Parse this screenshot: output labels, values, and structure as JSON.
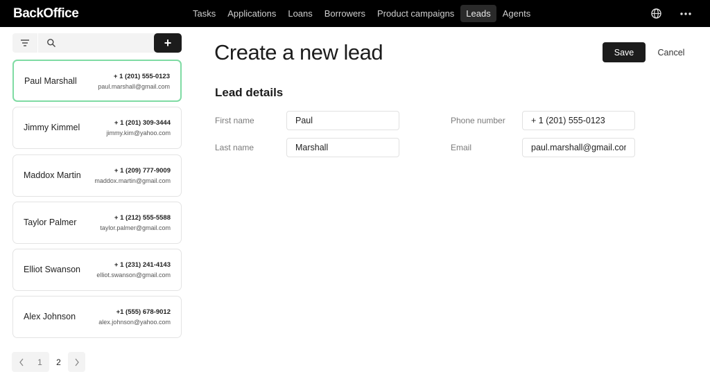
{
  "app": {
    "brand": "BackOffice"
  },
  "nav": {
    "items": [
      {
        "label": "Tasks",
        "active": false
      },
      {
        "label": "Applications",
        "active": false
      },
      {
        "label": "Loans",
        "active": false
      },
      {
        "label": "Borrowers",
        "active": false
      },
      {
        "label": "Product campaigns",
        "active": false
      },
      {
        "label": "Leads",
        "active": true
      },
      {
        "label": "Agents",
        "active": false
      }
    ],
    "icons": [
      "globe-icon",
      "more-icon"
    ]
  },
  "sidebar": {
    "filter_icon": "filter-icon",
    "search": {
      "icon": "search-icon",
      "placeholder": "",
      "value": ""
    },
    "add_label": "+",
    "leads": [
      {
        "name": "Paul Marshall",
        "phone": "+ 1 (201) 555-0123",
        "email": "paul.marshall@gmail.com",
        "selected": true
      },
      {
        "name": "Jimmy Kimmel",
        "phone": "+ 1 (201) 309-3444",
        "email": "jimmy.kim@yahoo.com",
        "selected": false
      },
      {
        "name": "Maddox Martin",
        "phone": "+ 1 (209) 777-9009",
        "email": "maddox.martin@gmail.com",
        "selected": false
      },
      {
        "name": "Taylor Palmer",
        "phone": "+ 1 (212) 555-5588",
        "email": "taylor.palmer@gmail.com",
        "selected": false
      },
      {
        "name": "Elliot Swanson",
        "phone": "+ 1 (231) 241-4143",
        "email": "elliot.swanson@gmail.com",
        "selected": false
      },
      {
        "name": "Alex Johnson",
        "phone": "+1 (555) 678-9012",
        "email": "alex.johnson@yahoo.com",
        "selected": false
      }
    ],
    "pagination": {
      "prev": "‹",
      "pages": [
        "1",
        "2"
      ],
      "current": "2",
      "next": "›"
    }
  },
  "main": {
    "title": "Create a new lead",
    "save_label": "Save",
    "cancel_label": "Cancel",
    "section_title": "Lead details",
    "fields": {
      "first_name": {
        "label": "First name",
        "value": "Paul"
      },
      "last_name": {
        "label": "Last name",
        "value": "Marshall"
      },
      "phone": {
        "label": "Phone number",
        "value": "+ 1 (201) 555-0123"
      },
      "email": {
        "label": "Email",
        "value": "paul.marshall@gmail.com"
      }
    }
  },
  "colors": {
    "topbar_bg": "#000000",
    "primary_button": "#1c1c1c",
    "selected_border": "#7fdba3"
  }
}
